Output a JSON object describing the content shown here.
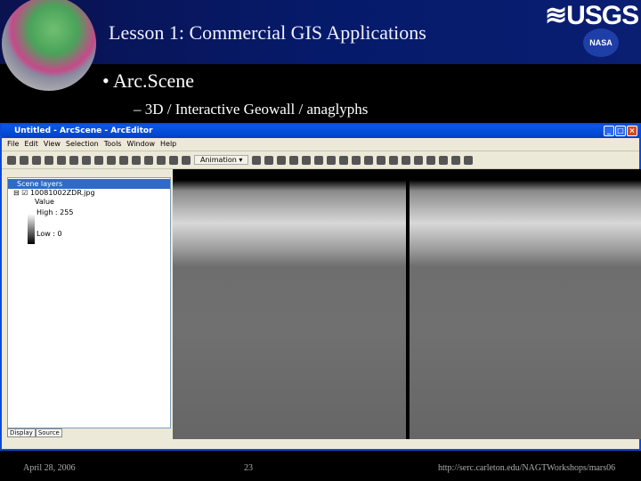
{
  "slide": {
    "title": "Lesson 1: Commercial GIS Applications",
    "bullet": "• Arc.Scene",
    "sub_bullet": "– 3D / Interactive Geowall / anaglyphs",
    "logos": {
      "usgs": "≋USGS",
      "nasa": "NASA"
    }
  },
  "window": {
    "title": "Untitled - ArcScene - ArcEditor",
    "controls": [
      "_",
      "□",
      "×"
    ],
    "menu": [
      "File",
      "Edit",
      "View",
      "Selection",
      "Tools",
      "Window",
      "Help"
    ],
    "toolbar": {
      "animation_label": "Animation ▾"
    },
    "toc": {
      "root": "Scene layers",
      "layer": "⊟ ☑ 10081002ZDR.jpg",
      "value_label": "Value",
      "high": "High : 255",
      "low": "Low : 0",
      "tabs": [
        "Display",
        "Source"
      ]
    }
  },
  "footer": {
    "date": "April 28, 2006",
    "page": "23",
    "url": "http://serc.carleton.edu/NAGTWorkshops/mars06"
  }
}
